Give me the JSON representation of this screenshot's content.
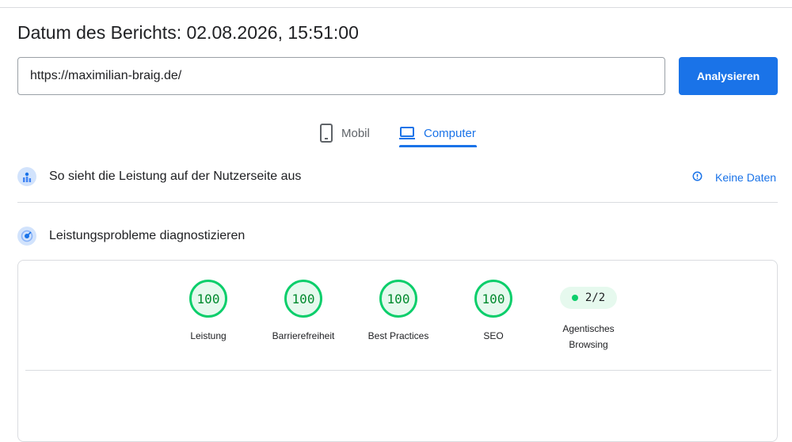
{
  "header": {
    "report_date": "Datum des Berichts: 02.08.2026, 15:51:00"
  },
  "search": {
    "url_value": "https://maximilian-braig.de/",
    "analyze_label": "Analysieren"
  },
  "tabs": [
    {
      "label": "Mobil",
      "icon": "phone-icon",
      "selected": false
    },
    {
      "label": "Computer",
      "icon": "laptop-icon",
      "selected": true
    }
  ],
  "field_data": {
    "title": "So sieht die Leistung auf der Nutzerseite aus",
    "no_data_label": "Keine Daten",
    "icon": "field-data-icon"
  },
  "diagnostics": {
    "title": "Leistungsprobleme diagnostizieren",
    "icon": "lab-data-icon"
  },
  "scores": [
    {
      "label": "Leistung",
      "value": "100"
    },
    {
      "label": "Barrierefreiheit",
      "value": "100"
    },
    {
      "label": "Best Practices",
      "value": "100"
    },
    {
      "label": "SEO",
      "value": "100"
    }
  ],
  "agentic": {
    "label_line1": "Agentisches",
    "label_line2": "Browsing",
    "value": "2/2"
  },
  "colors": {
    "accent": "#1a73e8",
    "pass": "#0cce6b",
    "pass_text": "#008a2e",
    "pass_bg": "#e6f9ee"
  }
}
